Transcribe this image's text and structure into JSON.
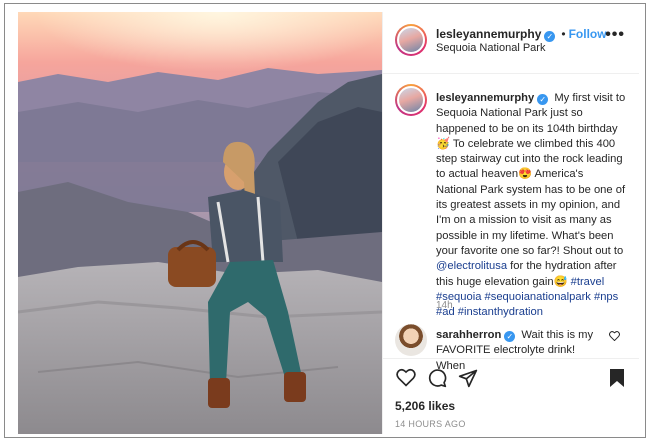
{
  "header": {
    "username": "lesleyannemurphy",
    "follow_label": "Follow",
    "separator": "•",
    "location": "Sequoia National Park",
    "more": "•••"
  },
  "caption": {
    "username": "lesleyannemurphy",
    "text": "My first visit to Sequoia National Park just so happened to be on its 104th birthday 🥳 To celebrate we climbed this 400 step stairway cut into the rock leading to actual heaven😍 America's National Park system has to be one of its greatest assets in my opinion, and I'm on a mission to visit as many as possible in my lifetime. What's been your favorite one so far?! Shout out to",
    "mention": "@electrolitusa",
    "text2": "for the hydration after this huge elevation gain😅",
    "hashtags": "#travel #sequoia #sequoianationalpark #nps #ad #instanthydration",
    "time": "14h"
  },
  "comment": {
    "username": "sarahherron",
    "text": "Wait this is my FAVORITE electrolyte drink! When"
  },
  "actions": {
    "likes": "5,206 likes",
    "ago": "14 HOURS AGO"
  },
  "icons": {
    "verified": "verified-badge-icon",
    "like": "heart-icon",
    "comment": "comment-icon",
    "share": "send-icon",
    "save": "bookmark-icon",
    "more": "more-options-icon"
  },
  "colors": {
    "accent": "#3897f0",
    "hashtag": "#1a3e8f",
    "muted": "#8e8e8e"
  }
}
